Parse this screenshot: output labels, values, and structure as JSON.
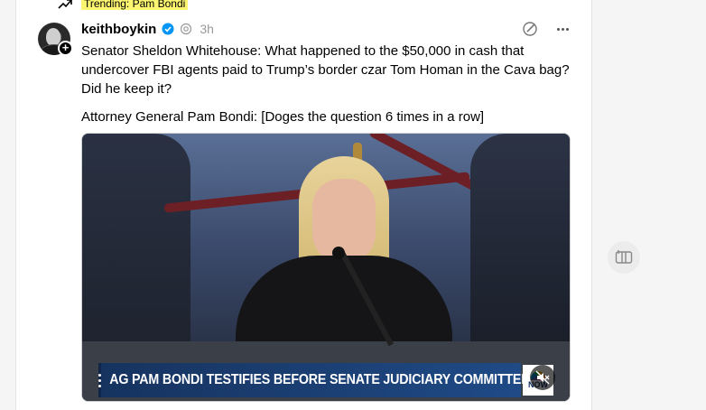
{
  "trending": {
    "icon": "trending-icon",
    "label": "Trending: Pam Bondi"
  },
  "post": {
    "username": "keithboykin",
    "verified_icon": "verified-badge-icon",
    "ai_icon": "ai-label-icon",
    "timestamp": "3h",
    "text_1": "Senator Sheldon Whitehouse: What happened to the $50,000 in cash that undercover FBI agents paid to Trump’s border czar Tom Homan in the Cava bag? Did he keep it?",
    "text_2": "Attorney General Pam Bondi: [Doges the question 6 times in a row]",
    "media": {
      "banner_text": "AG PAM BONDI TESTIFIES BEFORE SENATE JUDICIARY COMMITTEE",
      "network_logo_text": "NOW",
      "mute_icon": "muted-speaker-icon"
    }
  },
  "colors": {
    "trending_highlight": "#fbf56f",
    "verified": "#0095f6",
    "banner_blue": "#1f4a86"
  },
  "side_button": {
    "icon": "view-columns-icon"
  }
}
